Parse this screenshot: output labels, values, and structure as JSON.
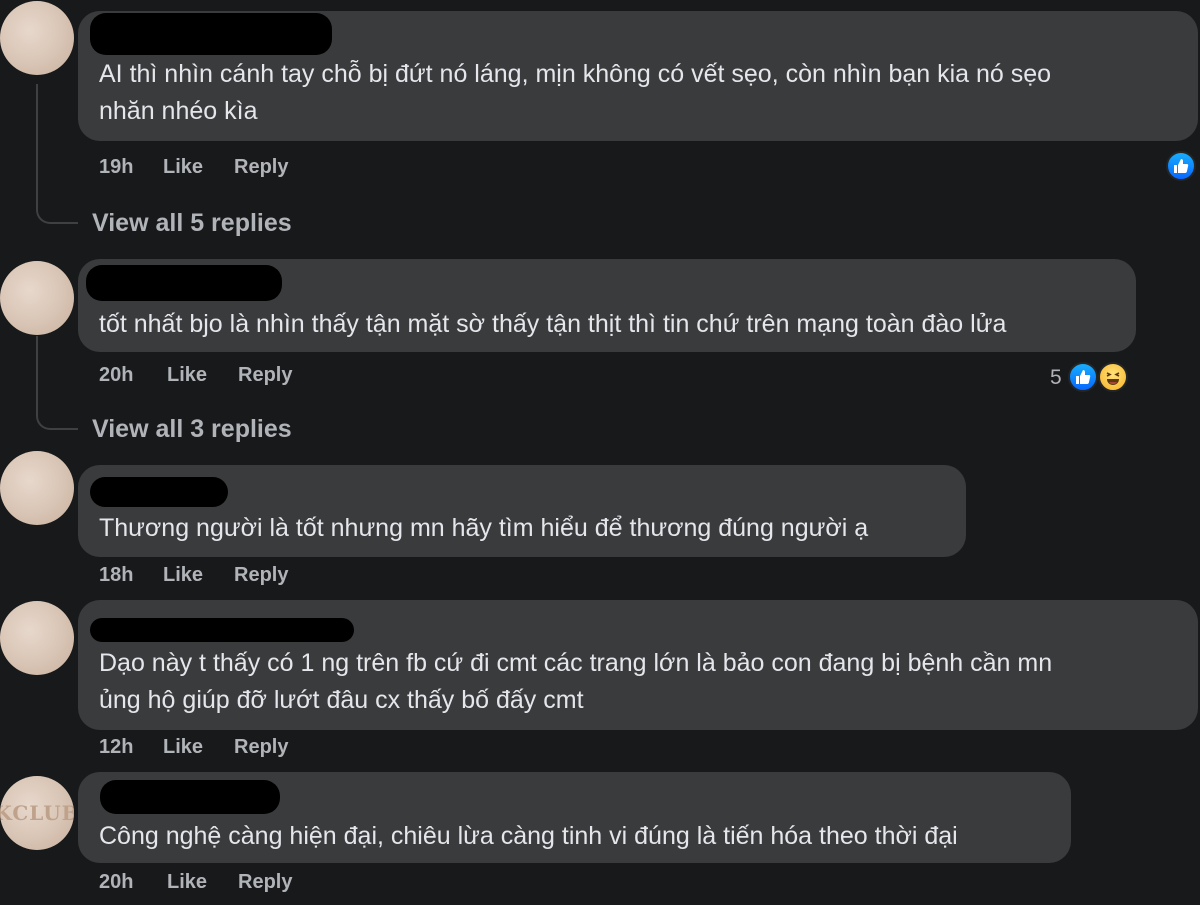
{
  "comments": [
    {
      "text_lines": [
        "AI thì nhìn cánh tay chỗ bị đứt nó láng, mịn không có vết sẹo, còn nhìn bạn kia nó sẹo",
        "nhăn nhéo kìa"
      ],
      "time": "19h",
      "like_label": "Like",
      "reply_label": "Reply",
      "view_replies": "View all 5 replies",
      "reactions": [
        "like-icon"
      ]
    },
    {
      "text_lines": [
        "tốt nhất bjo là nhìn thấy tận mặt sờ thấy tận thịt thì tin chứ trên mạng toàn đào lửa"
      ],
      "time": "20h",
      "like_label": "Like",
      "reply_label": "Reply",
      "view_replies": "View all 3 replies",
      "reaction_count": "5",
      "reactions": [
        "like-icon",
        "haha-icon"
      ]
    },
    {
      "text_lines": [
        "Thương người là tốt nhưng mn hãy tìm hiểu để thương đúng người ạ"
      ],
      "time": "18h",
      "like_label": "Like",
      "reply_label": "Reply"
    },
    {
      "text_lines": [
        "Dạo này t thấy có 1 ng trên fb cứ đi cmt các trang lớn là bảo con đang bị bệnh cần mn",
        "ủng hộ giúp đỡ lướt đâu cx thấy bố đấy cmt"
      ],
      "time": "12h",
      "like_label": "Like",
      "reply_label": "Reply"
    },
    {
      "text_lines": [
        "Công nghệ càng hiện đại, chiêu lừa càng tinh vi đúng là tiến hóa theo thời đại"
      ],
      "time": "20h",
      "like_label": "Like",
      "reply_label": "Reply",
      "avatar_text": "KCLUB"
    }
  ],
  "colors": {
    "background": "#18191a",
    "bubble": "#3a3b3c",
    "text": "#e4e6eb",
    "secondary_text": "#b0b3b8",
    "like_blue": "#0866ff"
  }
}
